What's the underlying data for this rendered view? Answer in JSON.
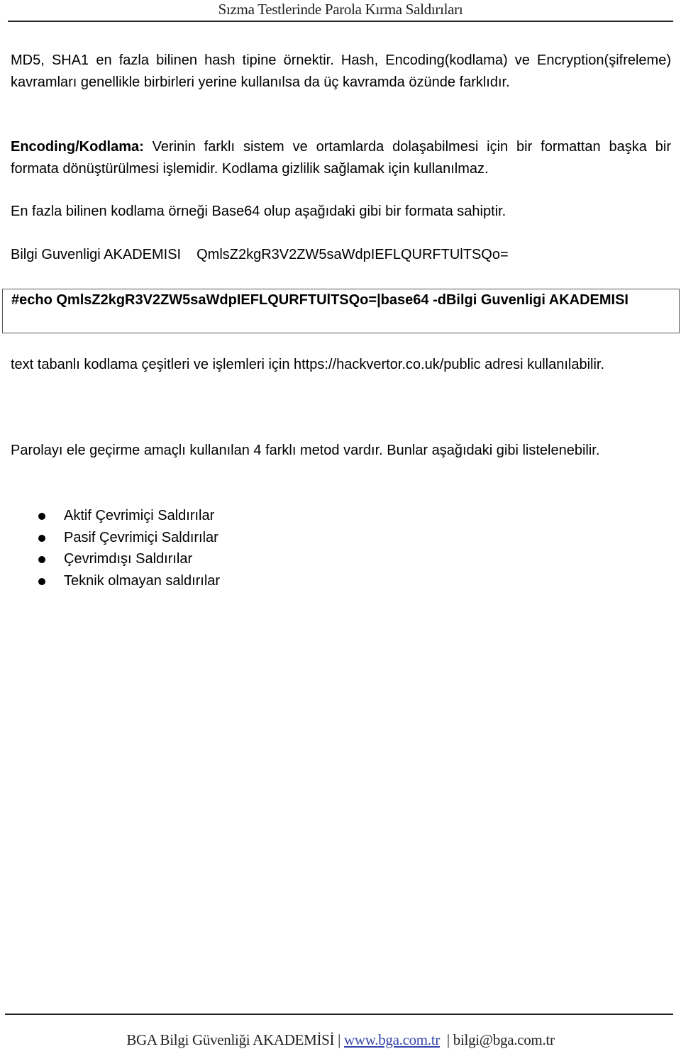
{
  "header": {
    "title": "Sızma Testlerinde Parola Kırma Saldırıları"
  },
  "content": {
    "intro": "MD5, SHA1 en fazla bilinen hash tipine örnektir. Hash, Encoding(kodlama) ve Encryption(şifreleme) kavramları genellikle birbirleri yerine kullanılsa da üç kavramda özünde farklıdır.",
    "encoding": {
      "term": "Encoding/Kodlama:",
      "definition": " Verinin farklı sistem ve ortamlarda dolaşabilmesi için bir formattan başka bir formata dönüştürülmesi işlemidir. Kodlama gizlilik sağlamak için kullanılmaz."
    },
    "base64_intro": "En fazla bilinen kodlama örneği Base64 olup aşağıdaki gibi bir formata sahiptir.",
    "example": {
      "plain": "Bilgi Guvenligi AKADEMISI",
      "encoded": "QmlsZ2kgR3V2ZW5saWdpIEFLQURFTUlTSQo="
    },
    "command": "#echo QmlsZ2kgR3V2ZW5saWdpIEFLQURFTUlTSQo=|base64 -dBilgi Guvenligi AKADEMISI",
    "hackvertor": "text tabanlı kodlama çeşitleri ve işlemleri için https://hackvertor.co.uk/public adresi kullanılabilir.",
    "methods_intro": "Parolayı ele geçirme amaçlı kullanılan 4 farklı metod vardır. Bunlar aşağıdaki gibi listelenebilir.",
    "methods": [
      "Aktif Çevrimiçi Saldırılar",
      "Pasif Çevrimiçi Saldırılar",
      "Çevrimdışı Saldırılar",
      "Teknik olmayan saldırılar"
    ]
  },
  "footer": {
    "org": "BGA Bilgi Güvenliği AKADEMİSİ | ",
    "website": "www.bga.com.tr",
    "separator": "  | ",
    "email": "bilgi@bga.com.tr",
    "link_color": "#3344aa"
  }
}
